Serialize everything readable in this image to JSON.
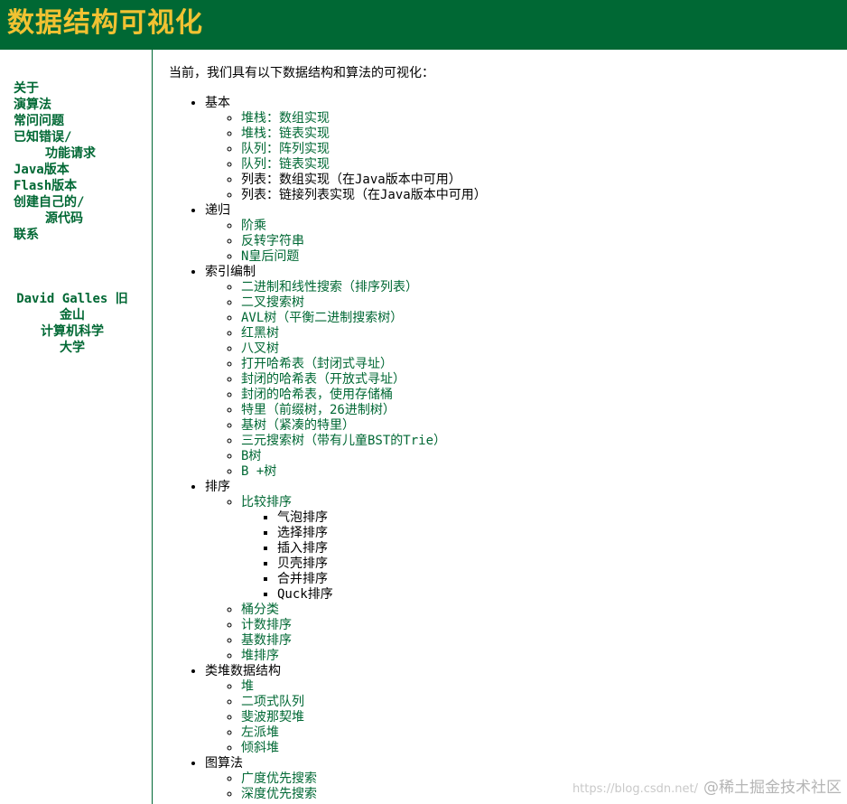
{
  "header": {
    "title": "数据结构可视化"
  },
  "sidebar": {
    "nav": [
      "关于",
      "演算法",
      "常问问题",
      "已知错误/",
      "功能请求",
      "Java版本",
      "Flash版本",
      "创建自己的/",
      "源代码",
      "联系"
    ],
    "author": [
      "David Galles 旧",
      "金山",
      "计算机科学",
      "大学"
    ]
  },
  "main": {
    "intro": "当前，我们具有以下数据结构和算法的可视化：",
    "sections": [
      {
        "title": "基本",
        "items": [
          "堆栈：数组实现",
          "堆栈：链表实现",
          "队列：阵列实现",
          "队列：链表实现",
          "列表：数组实现（在Java版本中可用）",
          "列表：链接列表实现（在Java版本中可用）"
        ]
      },
      {
        "title": "递归",
        "items": [
          "阶乘",
          "反转字符串",
          "N皇后问题"
        ]
      },
      {
        "title": "索引编制",
        "items": [
          "二进制和线性搜索（排序列表）",
          "二叉搜索树",
          "AVL树（平衡二进制搜索树）",
          "红黑树",
          "八叉树",
          "打开哈希表（封闭式寻址）",
          "封闭的哈希表（开放式寻址）",
          "封闭的哈希表，使用存储桶",
          "特里（前缀树，26进制树）",
          "基树（紧凑的特里）",
          "三元搜索树（带有儿童BST的Trie）",
          "B树",
          "B +树"
        ]
      },
      {
        "title": "排序",
        "sub_title": "比较排序",
        "sub_items": [
          "气泡排序",
          "选择排序",
          "插入排序",
          "贝壳排序",
          "合并排序",
          "Quck排序"
        ],
        "items": [
          "桶分类",
          "计数排序",
          "基数排序",
          "堆排序"
        ]
      },
      {
        "title": "类堆数据结构",
        "items": [
          "堆",
          "二项式队列",
          "斐波那契堆",
          "左派堆",
          "倾斜堆"
        ]
      },
      {
        "title": "图算法",
        "items": [
          "广度优先搜索",
          "深度优先搜索"
        ]
      }
    ]
  },
  "watermark": {
    "left": "https://blog.csdn.net/",
    "right": "@稀土掘金技术社区"
  },
  "colors": {
    "header_bg": "#006834",
    "title": "#f1c232",
    "link": "#006834"
  }
}
